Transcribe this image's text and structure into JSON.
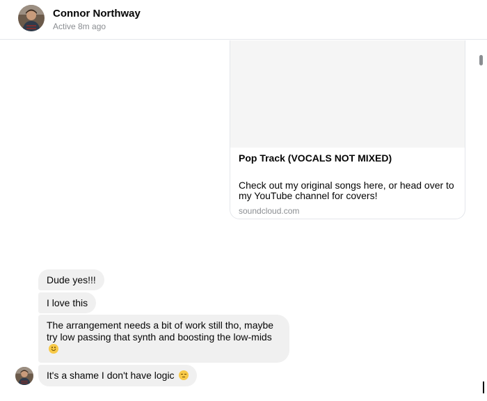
{
  "header": {
    "name": "Connor Northway",
    "status": "Active 8m ago"
  },
  "link_card": {
    "title": "Pop Track (VOCALS NOT MIXED)",
    "description": "Check out my original songs here, or head over to my YouTube channel for covers!",
    "domain": "soundcloud.com"
  },
  "messages": [
    {
      "text": "Dude yes!!!"
    },
    {
      "text": "I love this"
    },
    {
      "text": "The arrangement needs a bit of work still tho, maybe try low passing that synth and boosting the low-mids",
      "emoji": "slightly-smiling-face"
    },
    {
      "text": "It's a shame I don't have logic",
      "emoji": "pensive-face"
    }
  ],
  "colors": {
    "bubble": "#f0f0f0",
    "muted_text": "#8a8d91",
    "divider": "#e4e6eb"
  }
}
